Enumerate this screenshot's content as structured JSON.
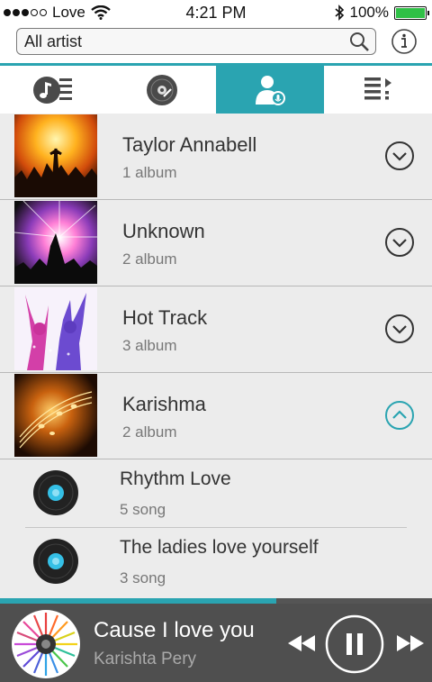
{
  "status_bar": {
    "carrier": "Love",
    "time": "4:21 PM",
    "battery": "100%"
  },
  "search": {
    "value": "All artist"
  },
  "tabs": [
    {
      "name": "songs",
      "icon": "music-note-list-icon",
      "active": false
    },
    {
      "name": "albums",
      "icon": "disc-icon",
      "active": false
    },
    {
      "name": "artists",
      "icon": "artist-mic-icon",
      "active": true
    },
    {
      "name": "playlists",
      "icon": "playlist-icon",
      "active": false
    }
  ],
  "artists": [
    {
      "name": "Taylor Annabell",
      "albums": "1 album",
      "expanded": false
    },
    {
      "name": "Unknown",
      "albums": "2 album",
      "expanded": false
    },
    {
      "name": "Hot Track",
      "albums": "3 album",
      "expanded": false
    },
    {
      "name": "Karishma",
      "albums": "2 album",
      "expanded": true
    }
  ],
  "albums": [
    {
      "title": "Rhythm Love",
      "songs": "5 song"
    },
    {
      "title": "The ladies love yourself",
      "songs": "3 song"
    }
  ],
  "now_playing": {
    "title": "Cause I love you",
    "artist": "Karishta Pery",
    "progress": 0.64
  },
  "colors": {
    "accent": "#2aa4b1",
    "battery": "#2fc046",
    "player_bg": "#4f4f4f"
  }
}
